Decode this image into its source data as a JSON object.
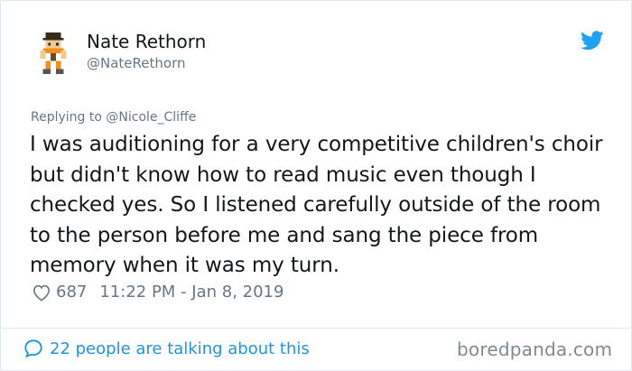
{
  "author": {
    "name": "Nate Rethorn",
    "handle": "@NateRethorn"
  },
  "tweet": {
    "replying_prefix": "Replying to ",
    "replying_to": "@Nicole_Cliffe",
    "text": "I was auditioning for a very competitive children's choir but didn't know how to read music even though I checked yes. So I listened carefully outside of the room to the person before me and sang the piece from memory when it was my turn.",
    "like_count": "687",
    "timestamp": "11:22 PM - Jan 8, 2019"
  },
  "footer": {
    "talking_text": "22 people are talking about this"
  },
  "watermark": "boredpanda.com",
  "colors": {
    "twitter_blue": "#1da1f2",
    "link_blue": "#1b95e0",
    "muted": "#657786"
  },
  "icons": {
    "avatar": "pixel-character-avatar",
    "brand": "twitter-bird-icon",
    "like": "heart-outline-icon",
    "talk": "speech-bubble-icon"
  }
}
